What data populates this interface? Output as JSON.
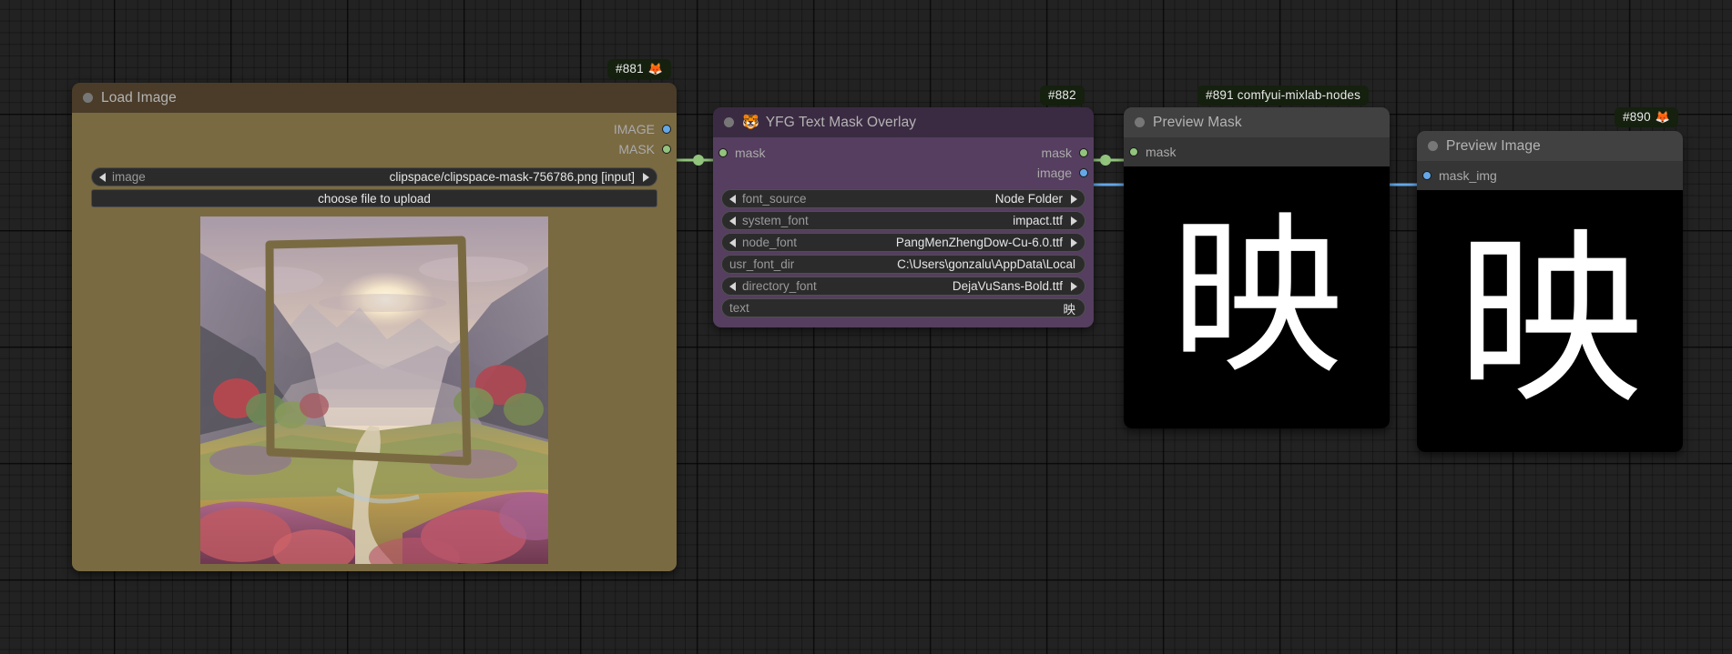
{
  "app": {
    "name": "ComfyUI Node Graph Canvas",
    "background_color": "#222222",
    "grid_color": "#1a1a1a"
  },
  "nodes": [
    {
      "id": "load-image",
      "badge": "#881",
      "badge_emoji": "🦊",
      "title": "Load Image",
      "header_color": "#4a3c29",
      "body_color": "#7a6a42",
      "outputs": [
        {
          "label": "IMAGE",
          "color": "#64a8e8",
          "type": "IMAGE"
        },
        {
          "label": "MASK",
          "color": "#92c47d",
          "type": "MASK"
        }
      ],
      "widgets": [
        {
          "name": "image",
          "value": "clipspace/clipspace-mask-756786.png [input]",
          "kind": "combo"
        },
        {
          "name": "choose file to upload",
          "value": "",
          "kind": "button"
        }
      ],
      "preview": {
        "kind": "image",
        "description": "painted mountain valley landscape at sunset with hand-drawn mask quadrilateral"
      }
    },
    {
      "id": "yfg-text-mask-overlay",
      "badge": "#882",
      "badge_emoji": "",
      "title": "YFG Text Mask Overlay",
      "title_emoji": "🐯",
      "header_color": "#3a2b42",
      "body_color": "#553e5f",
      "inputs": [
        {
          "label": "mask",
          "color": "#92c47d",
          "type": "MASK"
        }
      ],
      "outputs": [
        {
          "label": "mask",
          "color": "#92c47d",
          "type": "MASK"
        },
        {
          "label": "image",
          "color": "#64a8e8",
          "type": "IMAGE"
        }
      ],
      "widgets": [
        {
          "name": "font_source",
          "value": "Node Folder",
          "kind": "combo"
        },
        {
          "name": "system_font",
          "value": "impact.ttf",
          "kind": "combo"
        },
        {
          "name": "node_font",
          "value": "PangMenZhengDow-Cu-6.0.ttf",
          "kind": "combo"
        },
        {
          "name": "usr_font_dir",
          "value": "C:\\Users\\gonzalu\\AppData\\Local",
          "kind": "text"
        },
        {
          "name": "directory_font",
          "value": "DejaVuSans-Bold.ttf",
          "kind": "combo"
        },
        {
          "name": "text",
          "value": "映",
          "kind": "text"
        }
      ]
    },
    {
      "id": "preview-mask",
      "badge": "#891 comfyui-mixlab-nodes",
      "badge_emoji": "",
      "title": "Preview Mask",
      "header_color": "#414141",
      "body_color": "#353535",
      "inputs": [
        {
          "label": "mask",
          "color": "#92c47d",
          "type": "MASK"
        }
      ],
      "preview": {
        "kind": "mask",
        "glyph": "映",
        "bg": "#000000",
        "fg": "#ffffff"
      }
    },
    {
      "id": "preview-image",
      "badge": "#890",
      "badge_emoji": "🦊",
      "title": "Preview Image",
      "header_color": "#414141",
      "body_color": "#353535",
      "inputs": [
        {
          "label": "mask_img",
          "color": "#64a8e8",
          "type": "IMAGE"
        }
      ],
      "preview": {
        "kind": "mask",
        "glyph": "映",
        "bg": "#000000",
        "fg": "#ffffff"
      }
    }
  ],
  "links": [
    {
      "from": "load-image.MASK",
      "to": "yfg-text-mask-overlay.mask",
      "color": "#92c47d"
    },
    {
      "from": "yfg-text-mask-overlay.mask",
      "to": "preview-mask.mask",
      "color": "#92c47d"
    },
    {
      "from": "yfg-text-mask-overlay.image",
      "to": "preview-image.mask_img",
      "color": "#64a8e8"
    }
  ]
}
